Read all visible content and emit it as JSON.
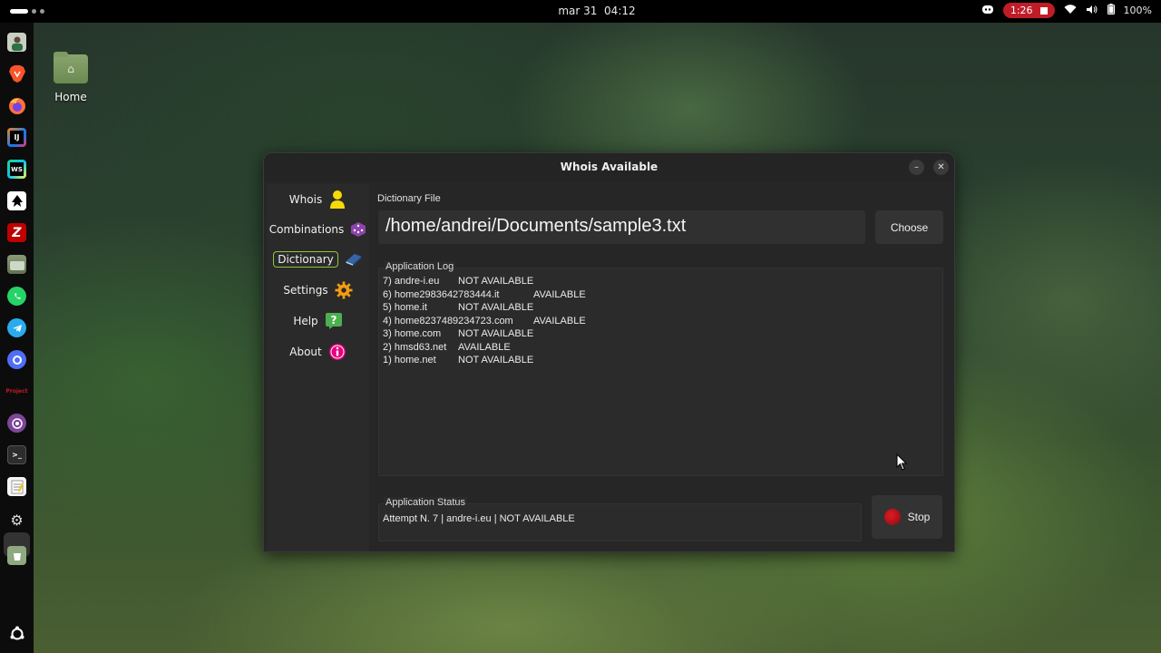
{
  "topbar": {
    "date": "mar 31",
    "time": "04:12",
    "recording": "1:26",
    "battery": "100%",
    "icons": [
      "activities-icon",
      "discord-icon",
      "wifi-icon",
      "volume-icon",
      "battery-icon"
    ]
  },
  "dock": {
    "apps": [
      "avatar-app",
      "brave-browser",
      "firefox",
      "intellij-idea",
      "webstorm",
      "inkscape",
      "filezilla",
      "files",
      "whatsapp",
      "telegram",
      "chat-app",
      "project-app",
      "tor-browser",
      "terminal",
      "text-editor",
      "settings",
      "trash",
      "show-apps"
    ],
    "project_label": "Project"
  },
  "desktop": {
    "home_label": "Home"
  },
  "window": {
    "title": "Whois Available",
    "sidebar": [
      {
        "label": "Whois",
        "icon": "person-icon",
        "color": "#f5d90a"
      },
      {
        "label": "Combinations",
        "icon": "dice-icon",
        "color": "#8e44ad"
      },
      {
        "label": "Dictionary",
        "icon": "book-icon",
        "color": "#3465a4"
      },
      {
        "label": "Settings",
        "icon": "gear-icon",
        "color": "#f39c12"
      },
      {
        "label": "Help",
        "icon": "help-icon",
        "color": "#4caf50"
      },
      {
        "label": "About",
        "icon": "info-icon",
        "color": "#e6007e"
      }
    ],
    "active_tab": "Dictionary",
    "dictionary_label": "Dictionary File",
    "file_path": "/home/andrei/Documents/sample3.txt",
    "choose_label": "Choose",
    "log_title": "Application Log",
    "log": [
      {
        "domain": "7) andre-i.eu",
        "status": "NOT AVAILABLE"
      },
      {
        "domain": "6) home2983642783444.it",
        "status": "AVAILABLE"
      },
      {
        "domain": "5) home.it",
        "status": "NOT AVAILABLE"
      },
      {
        "domain": "4) home8237489234723.com",
        "status": "AVAILABLE"
      },
      {
        "domain": "3) home.com",
        "status": "NOT AVAILABLE"
      },
      {
        "domain": "2) hmsd63.net",
        "status": "AVAILABLE"
      },
      {
        "domain": "1) home.net",
        "status": "NOT AVAILABLE"
      }
    ],
    "status_title": "Application Status",
    "status_text": "Attempt N. 7 | andre-i.eu | NOT AVAILABLE",
    "stop_label": "Stop"
  }
}
